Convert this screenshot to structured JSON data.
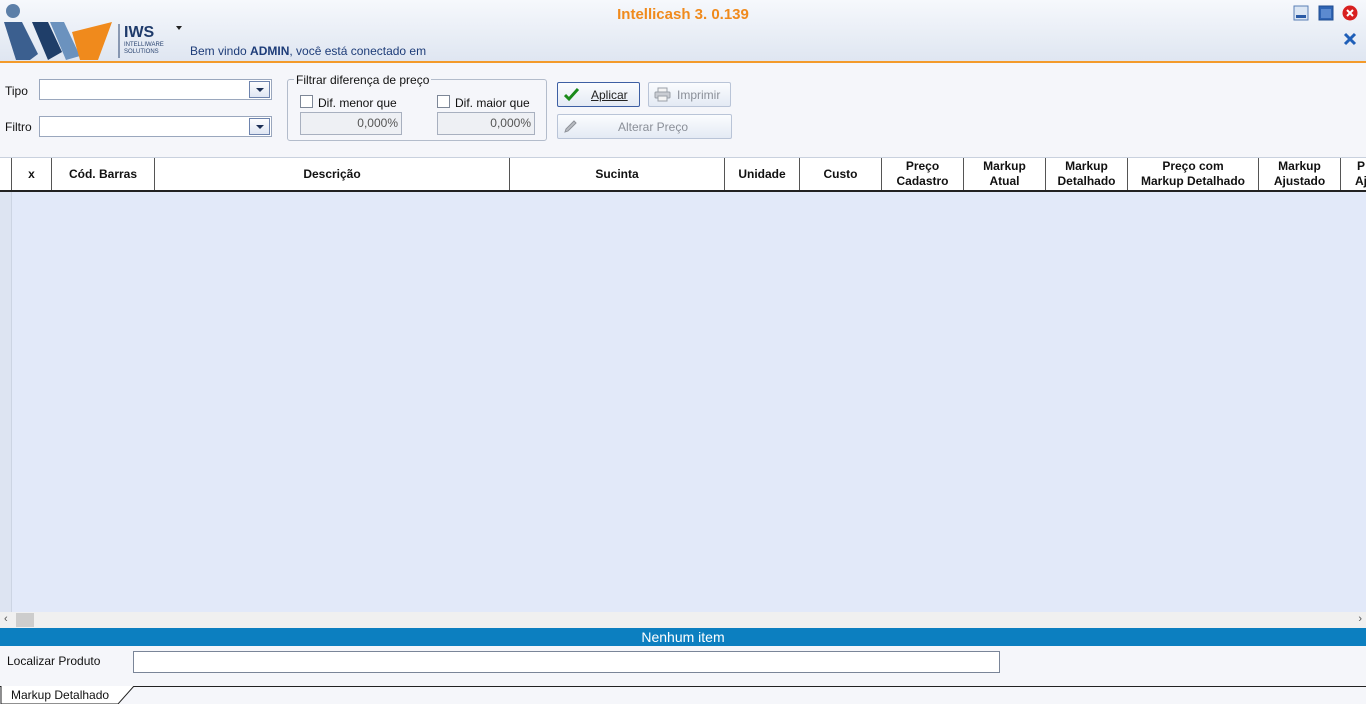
{
  "app": {
    "title": "Intellicash 3. 0.139",
    "logo_text": "IWS",
    "logo_sub1": "INTELLIWARE",
    "logo_sub2": "SOLUTIONS",
    "welcome_prefix": "Bem vindo ",
    "welcome_user": "ADMIN",
    "welcome_suffix": ", você está conectado em"
  },
  "filters": {
    "tipo_label": "Tipo",
    "tipo_value": "",
    "filtro_label": "Filtro",
    "filtro_value": "",
    "group_title": "Filtrar diferença de preço",
    "dif_menor_label": "Dif. menor que",
    "dif_menor_checked": false,
    "dif_menor_value": "0,000%",
    "dif_maior_label": "Dif. maior que",
    "dif_maior_checked": false,
    "dif_maior_value": "0,000%"
  },
  "buttons": {
    "aplicar": "Aplicar",
    "imprimir": "Imprimir",
    "alterar_preco": "Alterar Preço"
  },
  "grid": {
    "columns": [
      {
        "label": "x"
      },
      {
        "label": "Cód. Barras"
      },
      {
        "label": "Descrição"
      },
      {
        "label": "Sucinta"
      },
      {
        "label": "Unidade"
      },
      {
        "label": "Custo"
      },
      {
        "label": "Preço\nCadastro"
      },
      {
        "label": "Markup\nAtual"
      },
      {
        "label": "Markup\nDetalhado"
      },
      {
        "label": "Preço com\nMarkup Detalhado"
      },
      {
        "label": "Markup\nAjustado"
      },
      {
        "label": "P\nAj"
      }
    ],
    "rows": [],
    "status": "Nenhum item"
  },
  "search": {
    "label": "Localizar Produto",
    "value": ""
  },
  "tabs": [
    {
      "label": "Markup Detalhado",
      "active": true
    }
  ],
  "colors": {
    "accent": "#f08a1c",
    "status_bar": "#0c7fc0",
    "grid_bg": "#e2e9f9"
  }
}
